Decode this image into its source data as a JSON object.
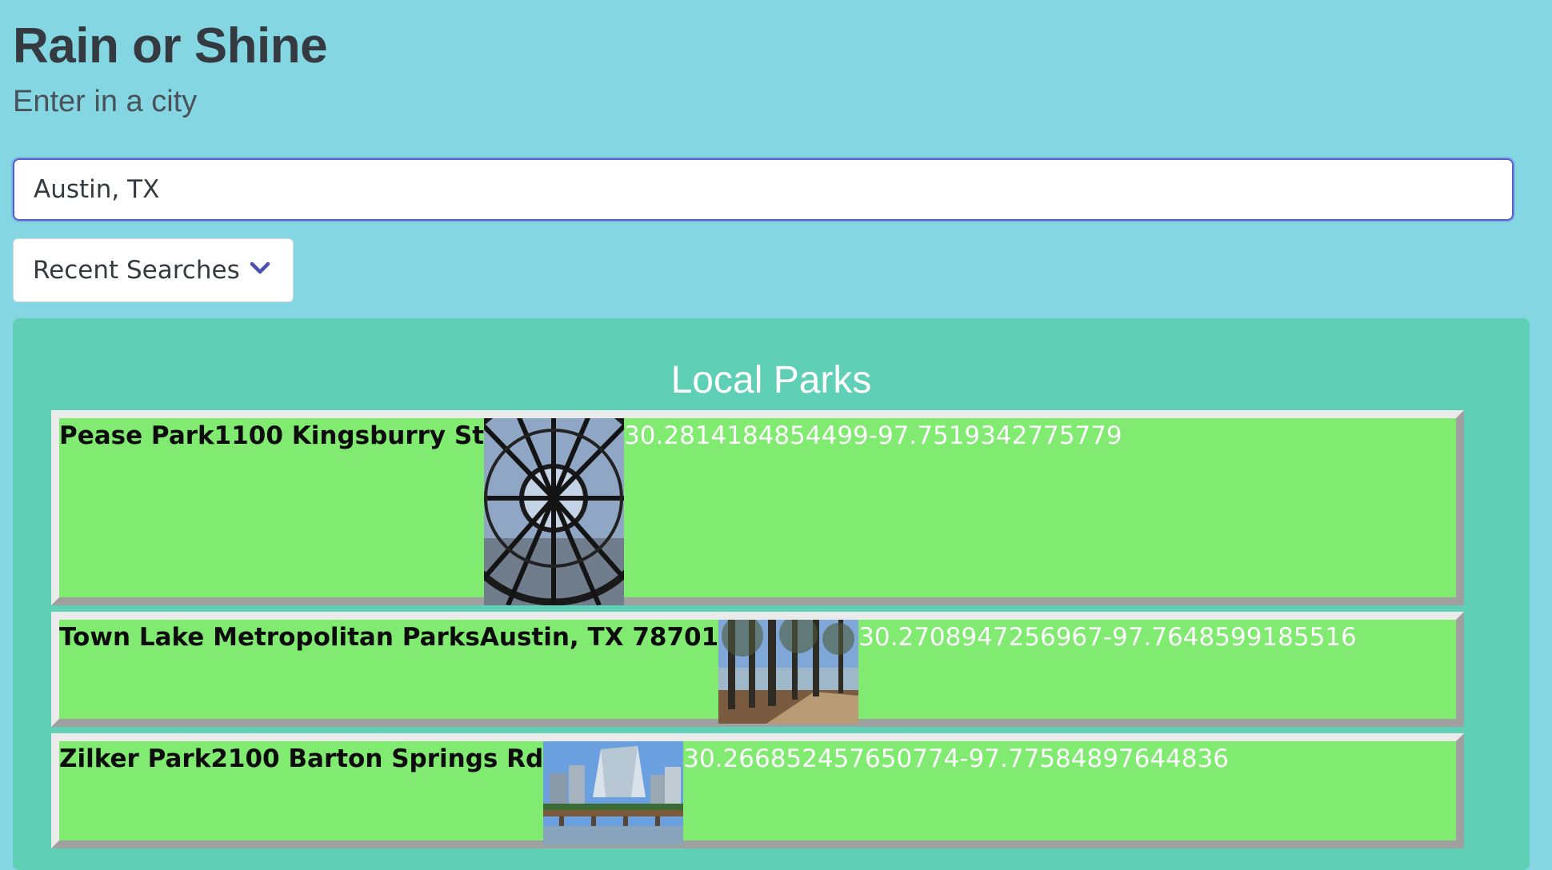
{
  "header": {
    "title": "Rain or Shine",
    "subtitle": "Enter in a city"
  },
  "search": {
    "value": "Austin, TX",
    "placeholder": ""
  },
  "recent_searches": {
    "label": "Recent Searches",
    "icon": "chevron-down-icon"
  },
  "parks_panel": {
    "title": "Local Parks",
    "items": [
      {
        "name_address": "Pease Park1100 Kingsburry St",
        "photo": "pease-park-photo",
        "coordinates": "30.2814184854499-97.7519342775779"
      },
      {
        "name_address": "Town Lake Metropolitan ParksAustin, TX 78701",
        "photo": "town-lake-photo",
        "coordinates": "30.2708947256967-97.7648599185516"
      },
      {
        "name_address": "Zilker Park2100 Barton Springs Rd",
        "photo": "zilker-park-photo",
        "coordinates": "30.266852457650774-97.77584897644836"
      }
    ]
  },
  "colors": {
    "page_background": "#84d6e3",
    "panel_background": "#5fcfb5",
    "park_item_background": "#81ea70",
    "input_focus_border": "#5560c9",
    "chevron": "#4a4fb0"
  }
}
